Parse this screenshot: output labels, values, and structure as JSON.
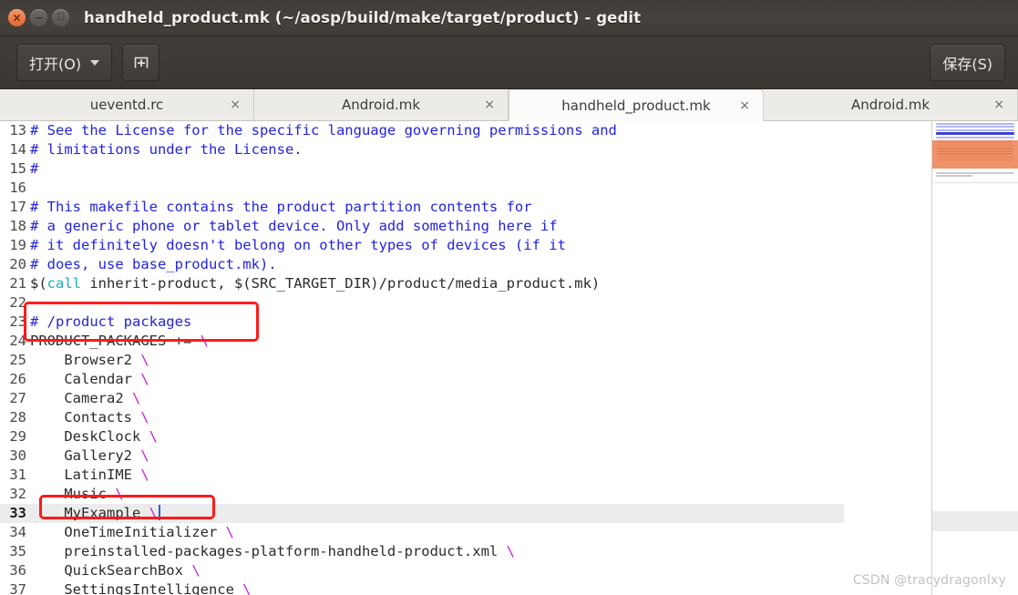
{
  "window": {
    "title": "handheld_product.mk (~/aosp/build/make/target/product) - gedit",
    "close_glyph": "×",
    "minimize_glyph": "−",
    "maximize_glyph": "□"
  },
  "toolbar": {
    "open_label": "打开(O)",
    "new_tab_title": "新建",
    "save_label": "保存(S)"
  },
  "tabs": [
    {
      "label": "ueventd.rc",
      "close": "×",
      "active": false
    },
    {
      "label": "Android.mk",
      "close": "×",
      "active": false
    },
    {
      "label": "handheld_product.mk",
      "close": "×",
      "active": true
    },
    {
      "label": "Android.mk",
      "close": "×",
      "active": false
    }
  ],
  "editor": {
    "language": "makefile",
    "current_line": 33,
    "first_visible_line": 13,
    "lines": [
      {
        "n": "13",
        "tokens": [
          {
            "t": "# See the License for the specific language governing permissions and",
            "c": "cm"
          }
        ]
      },
      {
        "n": "14",
        "tokens": [
          {
            "t": "# limitations under the License.",
            "c": "cm"
          }
        ]
      },
      {
        "n": "15",
        "tokens": [
          {
            "t": "#",
            "c": "cm"
          }
        ]
      },
      {
        "n": "16",
        "tokens": [
          {
            "t": "",
            "c": "pl"
          }
        ]
      },
      {
        "n": "17",
        "tokens": [
          {
            "t": "# This makefile contains the product partition contents for",
            "c": "cm"
          }
        ]
      },
      {
        "n": "18",
        "tokens": [
          {
            "t": "# a generic phone or tablet device. Only add something here if",
            "c": "cm"
          }
        ]
      },
      {
        "n": "19",
        "tokens": [
          {
            "t": "# it definitely doesn't belong on other types of devices (if it",
            "c": "cm"
          }
        ]
      },
      {
        "n": "20",
        "tokens": [
          {
            "t": "# does, use base_product.mk).",
            "c": "cm"
          }
        ]
      },
      {
        "n": "21",
        "tokens": [
          {
            "t": "$(",
            "c": "pl"
          },
          {
            "t": "call",
            "c": "fn"
          },
          {
            "t": " inherit-product, $(SRC_TARGET_DIR)/product/media_product.mk)",
            "c": "pl"
          }
        ]
      },
      {
        "n": "22",
        "tokens": [
          {
            "t": "",
            "c": "pl"
          }
        ]
      },
      {
        "n": "23",
        "tokens": [
          {
            "t": "# /product packages",
            "c": "cm"
          }
        ]
      },
      {
        "n": "24",
        "tokens": [
          {
            "t": "PRODUCT_PACKAGES += ",
            "c": "pl"
          },
          {
            "t": "\\",
            "c": "bs"
          }
        ]
      },
      {
        "n": "25",
        "tokens": [
          {
            "t": "    Browser2 ",
            "c": "pl"
          },
          {
            "t": "\\",
            "c": "bs"
          }
        ]
      },
      {
        "n": "26",
        "tokens": [
          {
            "t": "    Calendar ",
            "c": "pl"
          },
          {
            "t": "\\",
            "c": "bs"
          }
        ]
      },
      {
        "n": "27",
        "tokens": [
          {
            "t": "    Camera2 ",
            "c": "pl"
          },
          {
            "t": "\\",
            "c": "bs"
          }
        ]
      },
      {
        "n": "28",
        "tokens": [
          {
            "t": "    Contacts ",
            "c": "pl"
          },
          {
            "t": "\\",
            "c": "bs"
          }
        ]
      },
      {
        "n": "29",
        "tokens": [
          {
            "t": "    DeskClock ",
            "c": "pl"
          },
          {
            "t": "\\",
            "c": "bs"
          }
        ]
      },
      {
        "n": "30",
        "tokens": [
          {
            "t": "    Gallery2 ",
            "c": "pl"
          },
          {
            "t": "\\",
            "c": "bs"
          }
        ]
      },
      {
        "n": "31",
        "tokens": [
          {
            "t": "    LatinIME ",
            "c": "pl"
          },
          {
            "t": "\\",
            "c": "bs"
          }
        ]
      },
      {
        "n": "32",
        "tokens": [
          {
            "t": "    Music ",
            "c": "pl"
          },
          {
            "t": "\\",
            "c": "bs"
          }
        ]
      },
      {
        "n": "33",
        "tokens": [
          {
            "t": "    MyExample ",
            "c": "pl"
          },
          {
            "t": "\\",
            "c": "bs"
          }
        ],
        "current": true,
        "caret_after": true
      },
      {
        "n": "34",
        "tokens": [
          {
            "t": "    OneTimeInitializer ",
            "c": "pl"
          },
          {
            "t": "\\",
            "c": "bs"
          }
        ]
      },
      {
        "n": "35",
        "tokens": [
          {
            "t": "    preinstalled-packages-platform-handheld-product.xml ",
            "c": "pl"
          },
          {
            "t": "\\",
            "c": "bs"
          }
        ]
      },
      {
        "n": "36",
        "tokens": [
          {
            "t": "    QuickSearchBox ",
            "c": "pl"
          },
          {
            "t": "\\",
            "c": "bs"
          }
        ]
      },
      {
        "n": "37",
        "tokens": [
          {
            "t": "    SettingsIntelligence ",
            "c": "pl"
          },
          {
            "t": "\\",
            "c": "bs"
          }
        ]
      }
    ]
  },
  "annotations": [
    {
      "id": "redbox-product-packages",
      "covers": "lines 23-24 (# /product packages, PRODUCT_PACKAGES += \\)",
      "color": "#ff1a1a"
    },
    {
      "id": "redbox-myexample",
      "covers": "line 33 (MyExample \\)",
      "color": "#ff1a1a"
    }
  ],
  "watermark": {
    "text": "CSDN @tracydragonlxy"
  },
  "colors": {
    "titlebar": "#403c38",
    "toolbar": "#3a3733",
    "tab_active_bg": "#fbfbfa",
    "tab_inactive_bg": "#edebe8",
    "editor_bg": "#ffffff",
    "comment": "#2323e0",
    "function": "#15b2b2",
    "continuation": "#c81ee0",
    "current_line_bg": "#ececec",
    "annotation_red": "#ff1a1a",
    "minimap_highlight": "#ef8b5c"
  }
}
